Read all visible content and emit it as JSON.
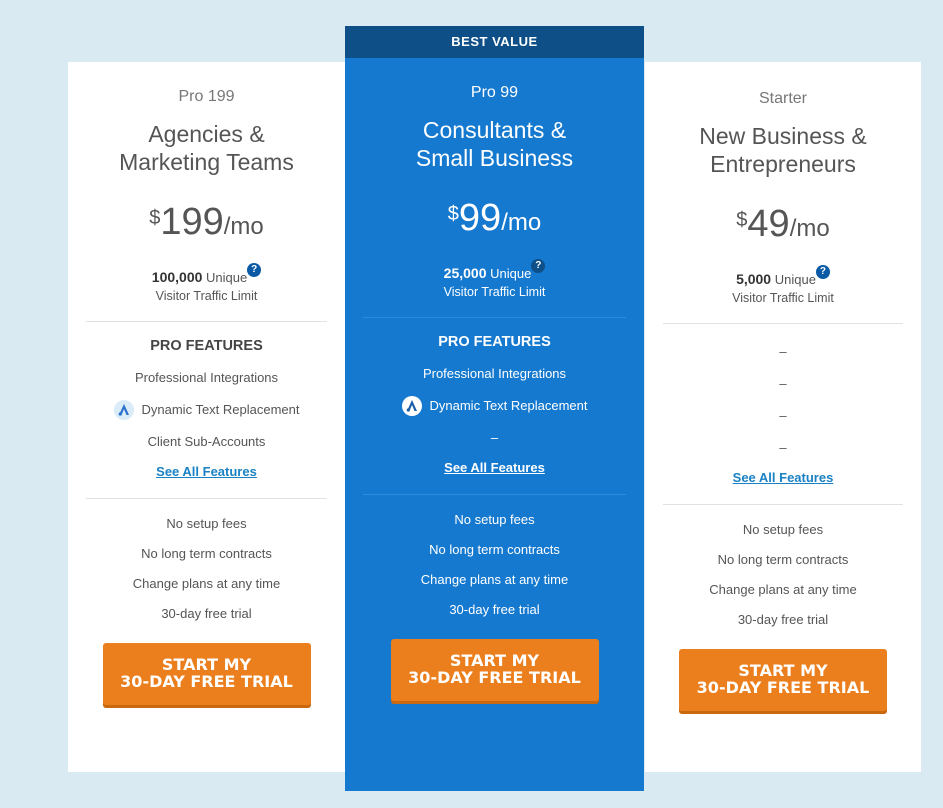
{
  "banner": "BEST VALUE",
  "plans": [
    {
      "name": "Pro 199",
      "audience_line1": "Agencies &",
      "audience_line2": "Marketing Teams",
      "currency": "$",
      "amount": "199",
      "period": "/mo",
      "visitors": "100,000",
      "unique": "Unique",
      "limit": "Visitor Traffic Limit",
      "features_title": "PRO FEATURES",
      "feature1": "Professional Integrations",
      "feature2": "Dynamic Text Replacement",
      "feature3": "Client Sub-Accounts",
      "see_all": "See All Features",
      "terms": [
        "No setup fees",
        "No long term contracts",
        "Change plans at any time",
        "30-day free trial"
      ],
      "cta_line1": "START MY",
      "cta_line2": "30-DAY FREE TRIAL"
    },
    {
      "name": "Pro 99",
      "audience_line1": "Consultants &",
      "audience_line2": "Small Business",
      "currency": "$",
      "amount": "99",
      "period": "/mo",
      "visitors": "25,000",
      "unique": "Unique",
      "limit": "Visitor Traffic Limit",
      "features_title": "PRO FEATURES",
      "feature1": "Professional Integrations",
      "feature2": "Dynamic Text Replacement",
      "feature3": "–",
      "see_all": "See All Features",
      "terms": [
        "No setup fees",
        "No long term contracts",
        "Change plans at any time",
        "30-day free trial"
      ],
      "cta_line1": "START MY",
      "cta_line2": "30-DAY FREE TRIAL"
    },
    {
      "name": "Starter",
      "audience_line1": "New Business &",
      "audience_line2": "Entrepreneurs",
      "currency": "$",
      "amount": "49",
      "period": "/mo",
      "visitors": "5,000",
      "unique": "Unique",
      "limit": "Visitor Traffic Limit",
      "dashes": [
        "–",
        "–",
        "–",
        "–"
      ],
      "see_all": "See All Features",
      "terms": [
        "No setup fees",
        "No long term contracts",
        "Change plans at any time",
        "30-day free trial"
      ],
      "cta_line1": "START MY",
      "cta_line2": "30-DAY FREE TRIAL"
    }
  ],
  "help_glyph": "?",
  "colors": {
    "background": "#d9eaf3",
    "highlight_card": "#1579cf",
    "banner": "#0e4f88",
    "cta": "#ec7f1d",
    "link": "#1a82c4"
  }
}
